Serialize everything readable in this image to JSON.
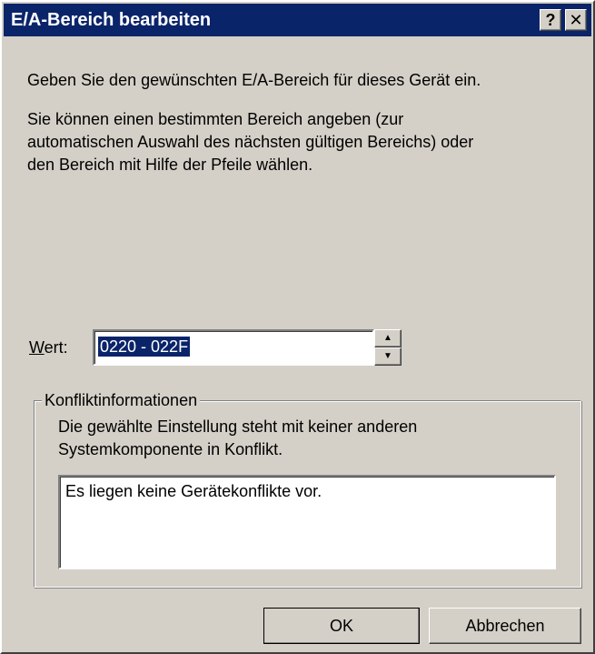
{
  "window": {
    "title": "E/A-Bereich bearbeiten",
    "help_label": "?",
    "close_label": "✕"
  },
  "intro": {
    "line1": "Geben Sie den gewünschten E/A-Bereich für dieses Gerät ein.",
    "line2a": "Sie können einen bestimmten Bereich angeben (zur",
    "line2b": "automatischen Auswahl des nächsten gültigen Bereichs) oder",
    "line2c": "den Bereich mit Hilfe der Pfeile wählen."
  },
  "wert": {
    "label_accel": "W",
    "label_rest": "ert:",
    "value": "0220 - 022F"
  },
  "conflict": {
    "legend": "Konfliktinformationen",
    "desc_line1": "Die gewählte Einstellung steht mit keiner anderen",
    "desc_line2": "Systemkomponente in Konflikt.",
    "box_text": "Es liegen keine Gerätekonflikte vor."
  },
  "buttons": {
    "ok": "OK",
    "cancel": "Abbrechen"
  }
}
